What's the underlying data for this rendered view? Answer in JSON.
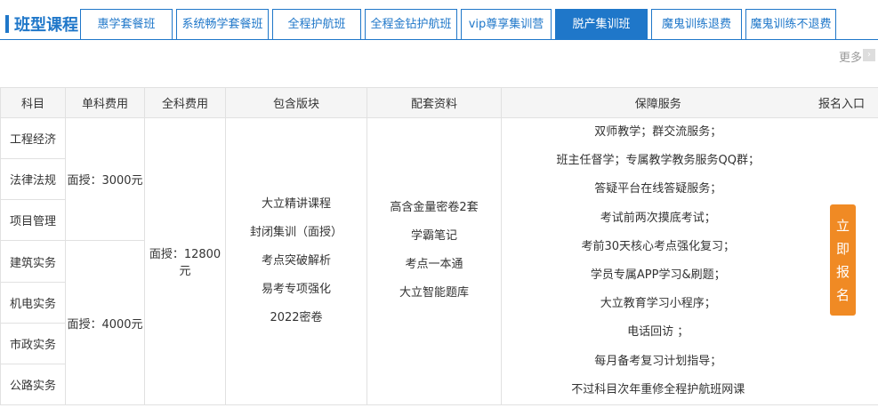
{
  "header": {
    "title": "班型课程",
    "tabs": [
      {
        "label": "惠学套餐班",
        "active": false
      },
      {
        "label": "系统畅学套餐班",
        "active": false
      },
      {
        "label": "全程护航班",
        "active": false
      },
      {
        "label": "全程金钻护航班",
        "active": false
      },
      {
        "label": "vip尊享集训营",
        "active": false
      },
      {
        "label": "脱产集训班",
        "active": true
      },
      {
        "label": "魔鬼训练退费",
        "active": false
      },
      {
        "label": "魔鬼训练不退费",
        "active": false
      }
    ],
    "more": "更多",
    "more_arrow": "›"
  },
  "table": {
    "headers": [
      "科目",
      "单科费用",
      "全科费用",
      "包含版块",
      "配套资料",
      "保障服务",
      "报名入口"
    ],
    "subjects": [
      "工程经济",
      "法律法规",
      "项目管理",
      "建筑实务",
      "机电实务",
      "市政实务",
      "公路实务"
    ],
    "single_fee_public": "面授：3000元",
    "single_fee_practice": "面授：4000元",
    "full_fee": "面授：12800元",
    "modules": [
      "大立精讲课程",
      "封闭集训（面授）",
      "考点突破解析",
      "易考专项强化",
      "2022密卷"
    ],
    "materials": [
      "高含金量密卷2套",
      "学霸笔记",
      "考点一本通",
      "大立智能题库"
    ],
    "services": [
      "双师教学；群交流服务；",
      "班主任督学；专属教学教务服务QQ群；",
      "答疑平台在线答疑服务；",
      "考试前两次摸底考试；",
      "考前30天核心考点强化复习；",
      "学员专属APP学习&刷题；",
      "大立教育学习小程序；",
      "电话回访 ；",
      "每月备考复习计划指导；",
      "不过科目次年重修全程护航班网课"
    ]
  },
  "signup": {
    "chars": [
      "立",
      "即",
      "报",
      "名"
    ]
  },
  "colors": {
    "accent": "#1f77c9",
    "signup": "#f08a24"
  }
}
